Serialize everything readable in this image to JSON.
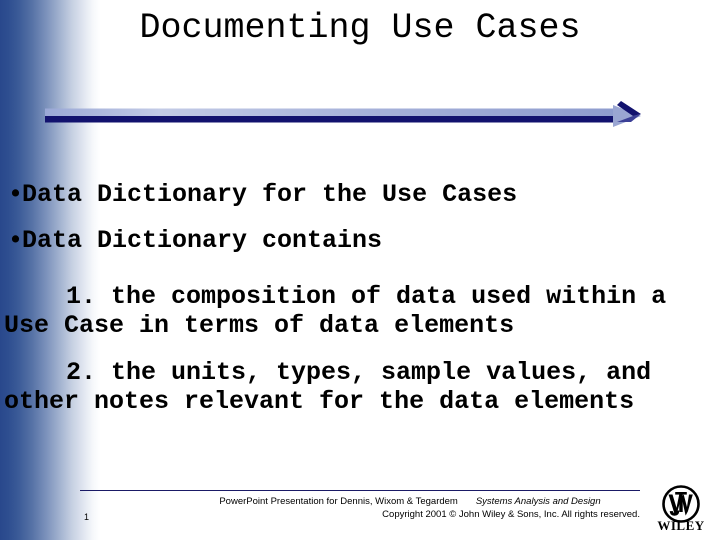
{
  "slide": {
    "title": "Documenting Use Cases",
    "page_number": "1",
    "background_color": "#ffffff",
    "accent_color": "#1a1a7a",
    "gradient_from": "#29488c",
    "gradient_to": "#ffffff"
  },
  "body": {
    "bullets": [
      {
        "marker": "•",
        "text": "Data Dictionary for the Use Cases"
      },
      {
        "marker": "•",
        "text": "Data Dictionary contains"
      }
    ],
    "numbered": [
      "1. the composition of data used within a Use Case in terms of data elements",
      "2. the units, types, sample values, and other notes relevant for the data elements"
    ]
  },
  "footer": {
    "credit": "PowerPoint Presentation for Dennis, Wixom & Tegardem",
    "book_title": "Systems Analysis and Design",
    "copyright": "Copyright 2001 © John Wiley & Sons, Inc.  All rights reserved.",
    "logo_word": "WILEY",
    "logo_monogram": "JW"
  },
  "icons": {
    "arrow_divider": "right-arrow-divider",
    "bullet": "bullet-dot-icon",
    "wiley": "wiley-logo-icon"
  }
}
